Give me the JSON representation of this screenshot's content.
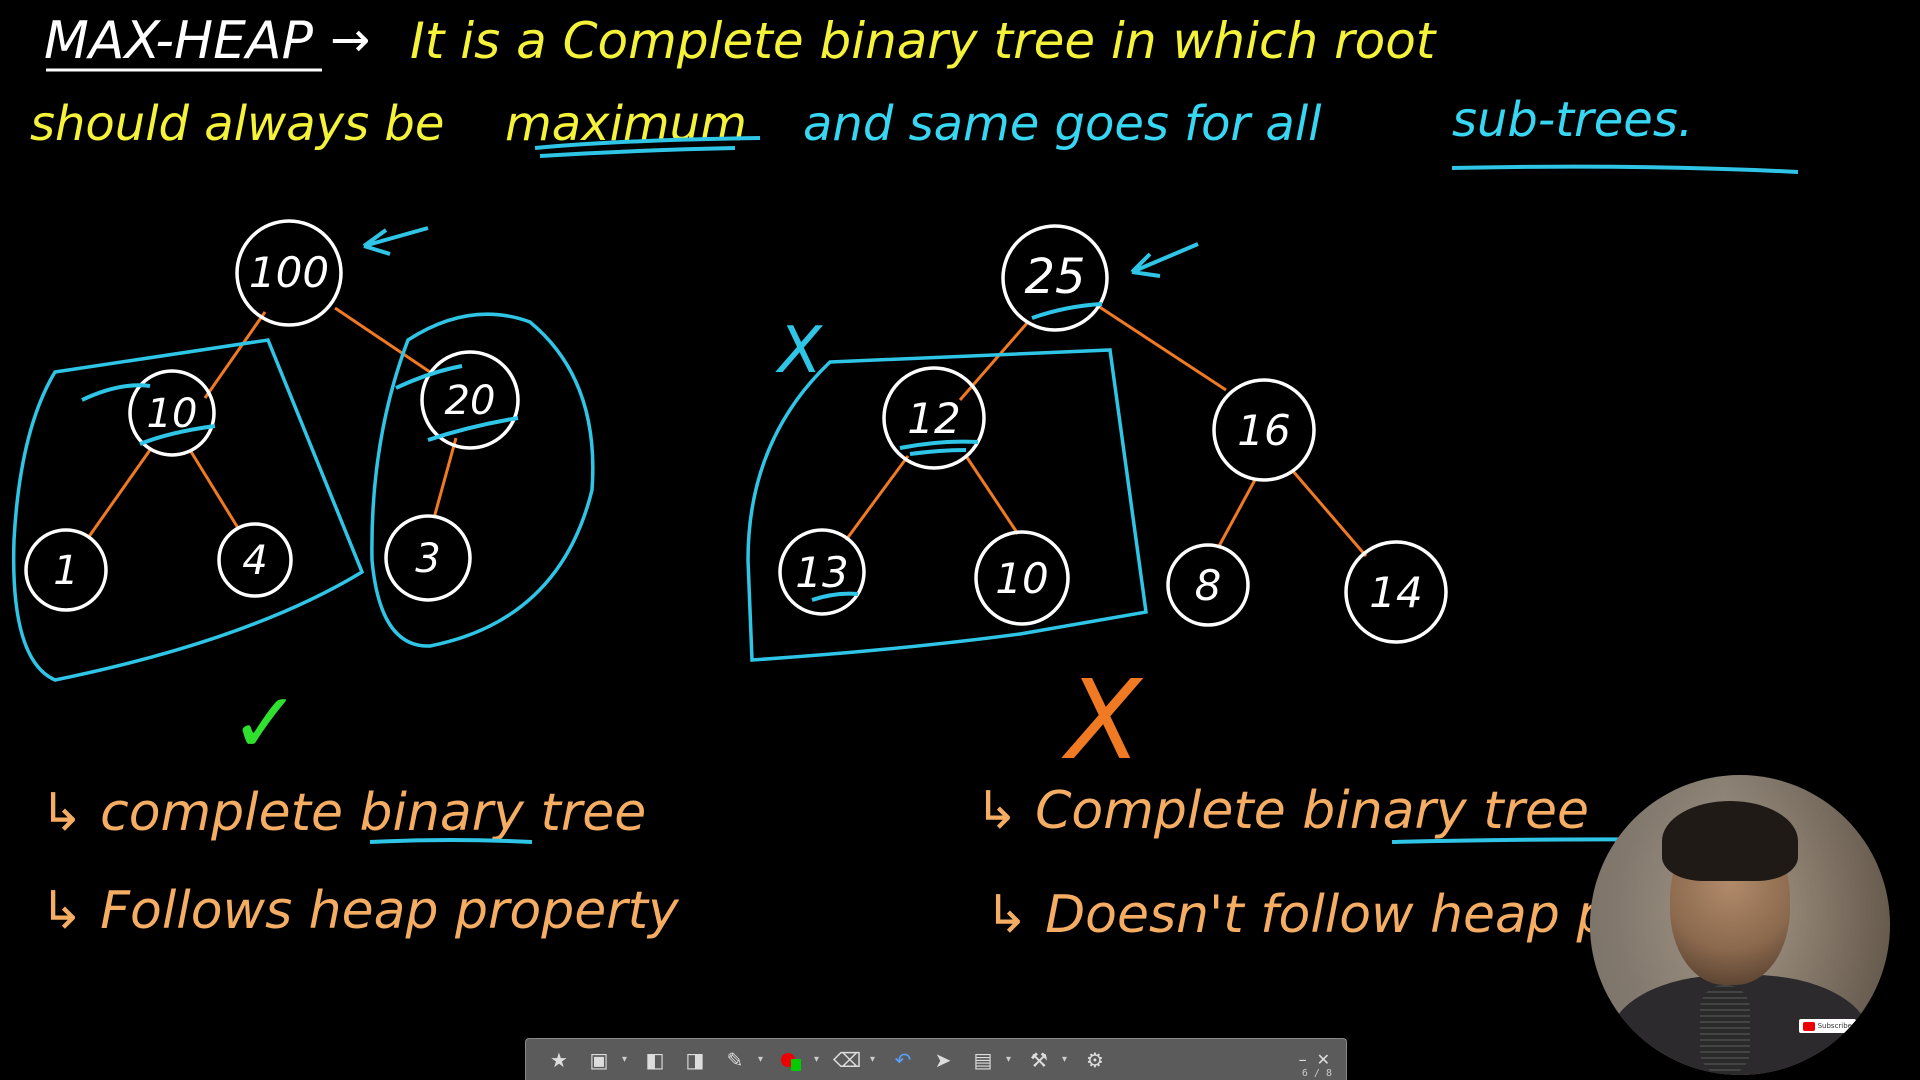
{
  "colors": {
    "background": "#000000",
    "header_primary": "#f5f23a",
    "header_secondary": "#37d6f2",
    "annotation": "#2fc5e6",
    "edge": "#f07a23",
    "bullets": "#f5ad63",
    "check": "#2fe02f",
    "node": "#ffffff"
  },
  "heading": {
    "term": "MAX-HEAP",
    "arrow": "→",
    "line1": "It is a Complete binary tree in which root",
    "line2_a": "should always be",
    "line2_word": "maximum",
    "line2_b": "and same goes for all",
    "line2_word2": "sub-trees."
  },
  "left_tree": {
    "nodes": [
      "100",
      "10",
      "20",
      "1",
      "4",
      "3"
    ],
    "verdict_mark": "✓",
    "bullets": [
      "↳ complete binary tree",
      "↳ Follows heap property"
    ]
  },
  "right_tree": {
    "nodes": [
      "25",
      "12",
      "16",
      "13",
      "10",
      "8",
      "14"
    ],
    "cross_mark": "X",
    "verdict_mark": "X",
    "bullets": [
      "↳ Complete binary tree",
      "↳ Doesn't follow heap property"
    ]
  },
  "toolbar": {
    "icons": [
      "favorites-icon",
      "save-icon",
      "undo-page-icon",
      "redo-page-icon",
      "pen-icon",
      "color-icon",
      "eraser-icon",
      "undo-icon",
      "pointer-icon",
      "background-icon",
      "tools-icon",
      "settings-icon"
    ],
    "minimize": "–",
    "close": "✕",
    "page": "6 / 8"
  },
  "webcam": {
    "badge": "Subscribe"
  }
}
